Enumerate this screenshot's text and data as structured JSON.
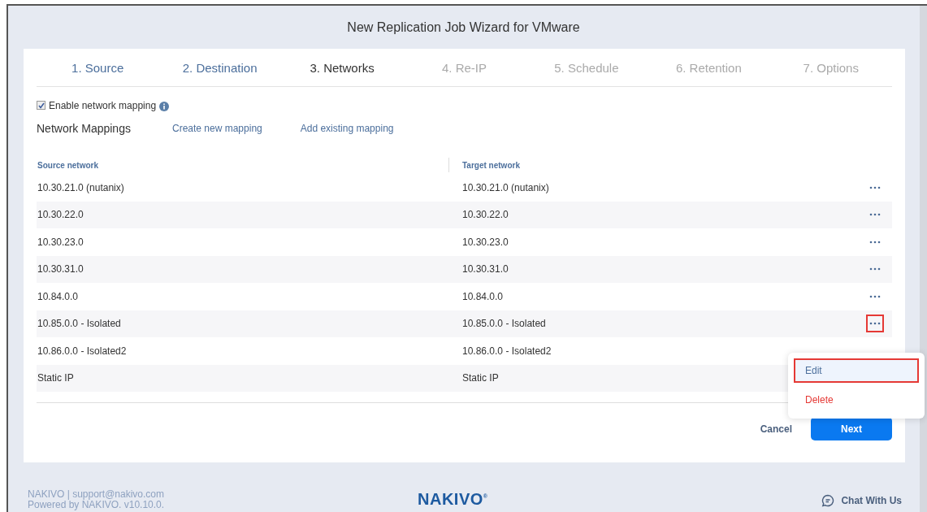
{
  "window": {
    "title": "New Replication Job Wizard for VMware"
  },
  "steps": [
    {
      "label": "1. Source",
      "selected": false,
      "disabled": false
    },
    {
      "label": "2. Destination",
      "selected": false,
      "disabled": false
    },
    {
      "label": "3. Networks",
      "selected": true,
      "disabled": false
    },
    {
      "label": "4. Re-IP",
      "selected": false,
      "disabled": true
    },
    {
      "label": "5. Schedule",
      "selected": false,
      "disabled": true
    },
    {
      "label": "6. Retention",
      "selected": false,
      "disabled": true
    },
    {
      "label": "7. Options",
      "selected": false,
      "disabled": true
    }
  ],
  "enable_mapping": {
    "label": "Enable network mapping",
    "checked": true
  },
  "mappings": {
    "title": "Network Mappings",
    "links": [
      "Create new mapping",
      "Add existing mapping"
    ]
  },
  "table": {
    "columns": [
      "Source network",
      "Target network"
    ],
    "rows": [
      {
        "source": "10.30.21.0 (nutanix)",
        "target": "10.30.21.0 (nutanix)",
        "more_button": true,
        "menu_open": false
      },
      {
        "source": "10.30.22.0",
        "target": "10.30.22.0",
        "more_button": true,
        "menu_open": false
      },
      {
        "source": "10.30.23.0",
        "target": "10.30.23.0",
        "more_button": true,
        "menu_open": false
      },
      {
        "source": "10.30.31.0",
        "target": "10.30.31.0",
        "more_button": true,
        "menu_open": false
      },
      {
        "source": "10.84.0.0",
        "target": "10.84.0.0",
        "more_button": true,
        "menu_open": false
      },
      {
        "source": "10.85.0.0 - Isolated",
        "target": "10.85.0.0 - Isolated",
        "more_button": true,
        "menu_open": true
      },
      {
        "source": "10.86.0.0 - Isolated2",
        "target": "10.86.0.0 - Isolated2",
        "more_button": false,
        "menu_open": false
      },
      {
        "source": "Static IP",
        "target": "Static IP",
        "more_button": false,
        "menu_open": false
      }
    ]
  },
  "menu": [
    {
      "label": "Edit",
      "kind": "normal",
      "highlighted": true
    },
    {
      "label": "Delete",
      "kind": "danger",
      "highlighted": false
    }
  ],
  "buttons": {
    "cancel": "Cancel",
    "next": "Next"
  },
  "footer": {
    "contact": "NAKIVO | support@nakivo.com",
    "version": "Powered by NAKIVO. v10.10.0.",
    "logo": "NAKIVO$^{®}$",
    "chat": "Chat With Us"
  }
}
